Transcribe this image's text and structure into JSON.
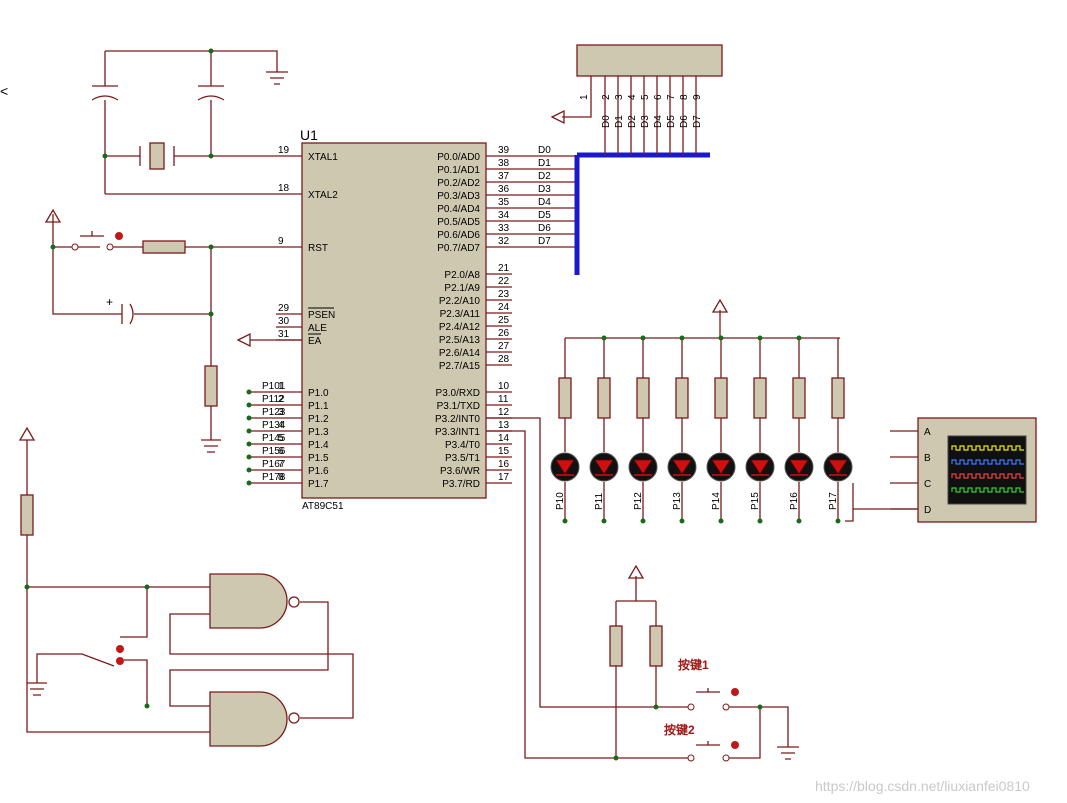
{
  "mcu": {
    "ref": "U1",
    "part": "AT89C51",
    "left_pins": [
      {
        "num": "19",
        "name": "XTAL1"
      },
      {
        "num": "18",
        "name": "XTAL2"
      },
      {
        "num": "9",
        "name": "RST"
      },
      {
        "num": "29",
        "name": "PSEN"
      },
      {
        "num": "30",
        "name": "ALE"
      },
      {
        "num": "31",
        "name": "EA"
      },
      {
        "num": "1",
        "name": "P1.0"
      },
      {
        "num": "2",
        "name": "P1.1"
      },
      {
        "num": "3",
        "name": "P1.2"
      },
      {
        "num": "4",
        "name": "P1.3"
      },
      {
        "num": "5",
        "name": "P1.4"
      },
      {
        "num": "6",
        "name": "P1.5"
      },
      {
        "num": "7",
        "name": "P1.6"
      },
      {
        "num": "8",
        "name": "P1.7"
      }
    ],
    "p1_labels": [
      "P101",
      "P112",
      "P123",
      "P134",
      "P145",
      "P156",
      "P167",
      "P178"
    ],
    "p0_pins": [
      {
        "num": "39",
        "name": "P0.0/AD0",
        "net": "D0"
      },
      {
        "num": "38",
        "name": "P0.1/AD1",
        "net": "D1"
      },
      {
        "num": "37",
        "name": "P0.2/AD2",
        "net": "D2"
      },
      {
        "num": "36",
        "name": "P0.3/AD3",
        "net": "D3"
      },
      {
        "num": "35",
        "name": "P0.4/AD4",
        "net": "D4"
      },
      {
        "num": "34",
        "name": "P0.5/AD5",
        "net": "D5"
      },
      {
        "num": "33",
        "name": "P0.6/AD6",
        "net": "D6"
      },
      {
        "num": "32",
        "name": "P0.7/AD7",
        "net": "D7"
      }
    ],
    "p2_pins": [
      {
        "num": "21",
        "name": "P2.0/A8"
      },
      {
        "num": "22",
        "name": "P2.1/A9"
      },
      {
        "num": "23",
        "name": "P2.2/A10"
      },
      {
        "num": "24",
        "name": "P2.3/A11"
      },
      {
        "num": "25",
        "name": "P2.4/A12"
      },
      {
        "num": "26",
        "name": "P2.5/A13"
      },
      {
        "num": "27",
        "name": "P2.6/A14"
      },
      {
        "num": "28",
        "name": "P2.7/A15"
      }
    ],
    "p3_pins": [
      {
        "num": "10",
        "name": "P3.0/RXD"
      },
      {
        "num": "11",
        "name": "P3.1/TXD"
      },
      {
        "num": "12",
        "name": "P3.2/INT0"
      },
      {
        "num": "13",
        "name": "P3.3/INT1"
      },
      {
        "num": "14",
        "name": "P3.4/T0"
      },
      {
        "num": "15",
        "name": "P3.5/T1"
      },
      {
        "num": "16",
        "name": "P3.6/WR"
      },
      {
        "num": "17",
        "name": "P3.7/RD"
      }
    ]
  },
  "resistor_pack": {
    "common_pin": "1",
    "pins": [
      "2",
      "3",
      "4",
      "5",
      "6",
      "7",
      "8",
      "9"
    ],
    "nets": [
      "D0",
      "D1",
      "D2",
      "D3",
      "D4",
      "D5",
      "D6",
      "D7"
    ]
  },
  "leds": [
    "P10",
    "P11",
    "P12",
    "P13",
    "P14",
    "P15",
    "P16",
    "P17"
  ],
  "scope": {
    "channels": [
      "A",
      "B",
      "C",
      "D"
    ],
    "colors": [
      "#e8e800",
      "#3a7bff",
      "#e84040",
      "#30d030"
    ]
  },
  "buttons": {
    "key1": "按键1",
    "key2": "按键2"
  },
  "watermark": "https://blog.csdn.net/liuxianfei0810",
  "stray_glyph": "<",
  "colors": {
    "wire": "#7a1a1a",
    "component": "#cfc8b0",
    "bus": "#1a1acc",
    "node": "#1b6a1b",
    "pin_dot": "#c01818"
  }
}
